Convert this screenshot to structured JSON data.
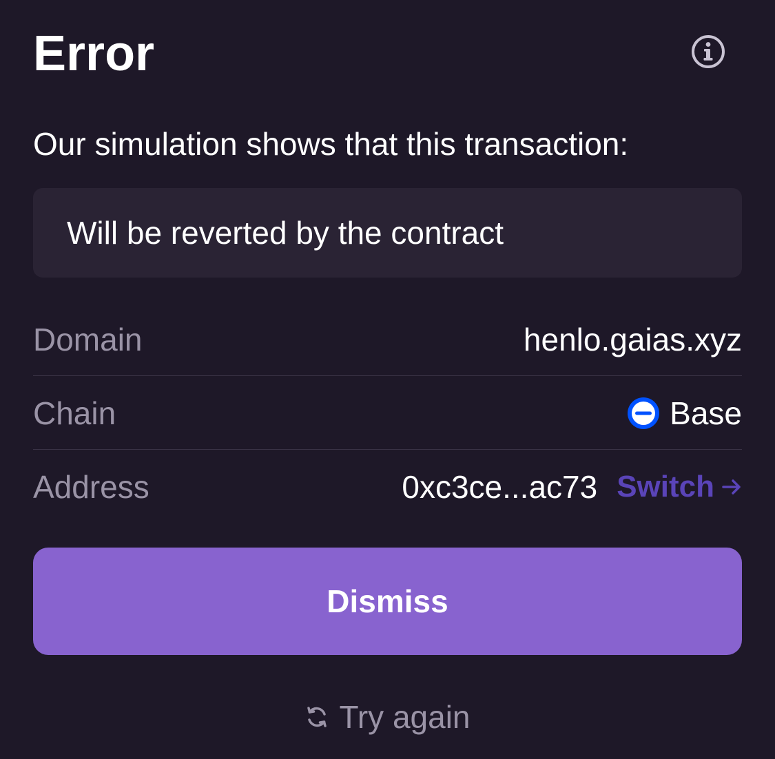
{
  "header": {
    "title": "Error",
    "info_icon": "info-circle-icon"
  },
  "simulation": {
    "intro": "Our simulation shows that this transaction:",
    "result": "Will be reverted by the contract"
  },
  "details": {
    "domain": {
      "label": "Domain",
      "value": "henlo.gaias.xyz"
    },
    "chain": {
      "label": "Chain",
      "value": "Base",
      "icon": "base-chain-icon",
      "icon_color": "#0052ff"
    },
    "address": {
      "label": "Address",
      "value": "0xc3ce...ac73",
      "switch_label": "Switch",
      "switch_icon": "arrow-right-icon"
    }
  },
  "actions": {
    "dismiss_label": "Dismiss",
    "try_again_label": "Try again",
    "try_again_icon": "refresh-icon"
  },
  "colors": {
    "background": "#1e1828",
    "card": "#2a2334",
    "accent": "#8863cf",
    "link": "#5a44b8",
    "muted": "#9a93a6"
  }
}
